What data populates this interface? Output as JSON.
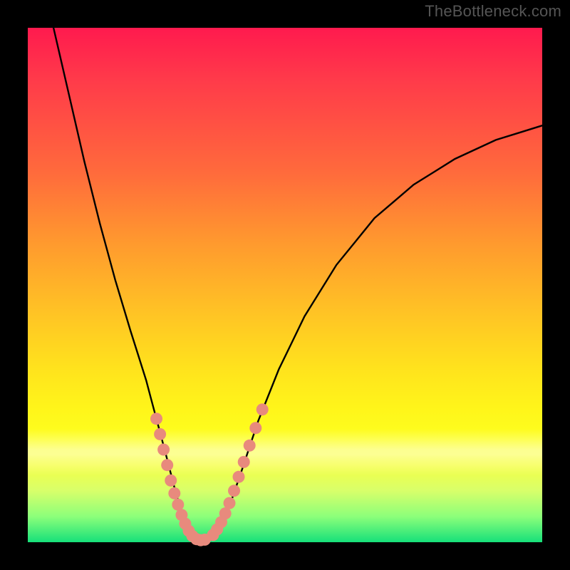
{
  "watermark": {
    "text": "TheBottleneck.com"
  },
  "colors": {
    "frame": "#000000",
    "curve": "#000000",
    "beads": "#e88a7d",
    "gradient_stops": [
      "#ff1a4e",
      "#ff3a4a",
      "#ff6a3c",
      "#ff9a2e",
      "#ffc225",
      "#ffe21d",
      "#fff51a",
      "#fdff1f",
      "#f5ff45",
      "#d8ff6a",
      "#8cff7a",
      "#16e07a"
    ]
  },
  "chart_data": {
    "type": "line",
    "title": "",
    "xlabel": "",
    "ylabel": "",
    "xlim": [
      0,
      100
    ],
    "ylim": [
      0,
      100
    ],
    "grid": false,
    "series": [
      {
        "name": "curve",
        "x": [
          5,
          8,
          11,
          14,
          17,
          20,
          23,
          25,
          27,
          28.8,
          30.3,
          31.6,
          32.7,
          33.8,
          34.9,
          36,
          37.5,
          39.3,
          41.7,
          44.8,
          48.8,
          53.8,
          60,
          67.4,
          75,
          83,
          91,
          100
        ],
        "y": [
          100,
          87,
          74,
          62,
          51,
          41,
          31.5,
          24,
          16.5,
          9.5,
          4.5,
          1.7,
          0.6,
          0.4,
          0.6,
          1.2,
          3.2,
          7.3,
          14.3,
          23.6,
          33.6,
          43.9,
          53.9,
          63,
          69.5,
          74.5,
          78.2,
          81
        ]
      }
    ],
    "bead_clusters": [
      {
        "name": "left-cluster",
        "points": [
          {
            "x": 25.0,
            "y": 24.0
          },
          {
            "x": 25.7,
            "y": 21.0
          },
          {
            "x": 26.4,
            "y": 18.0
          },
          {
            "x": 27.1,
            "y": 15.0
          },
          {
            "x": 27.8,
            "y": 12.0
          },
          {
            "x": 28.5,
            "y": 9.5
          },
          {
            "x": 29.2,
            "y": 7.3
          },
          {
            "x": 29.9,
            "y": 5.3
          },
          {
            "x": 30.6,
            "y": 3.6
          },
          {
            "x": 31.3,
            "y": 2.2
          },
          {
            "x": 32.0,
            "y": 1.2
          },
          {
            "x": 32.8,
            "y": 0.6
          },
          {
            "x": 33.6,
            "y": 0.4
          },
          {
            "x": 34.4,
            "y": 0.5
          }
        ]
      },
      {
        "name": "right-cluster",
        "points": [
          {
            "x": 36.0,
            "y": 1.4
          },
          {
            "x": 36.8,
            "y": 2.5
          },
          {
            "x": 37.6,
            "y": 3.9
          },
          {
            "x": 38.4,
            "y": 5.6
          },
          {
            "x": 39.2,
            "y": 7.6
          },
          {
            "x": 40.1,
            "y": 10.0
          },
          {
            "x": 41.0,
            "y": 12.7
          },
          {
            "x": 42.0,
            "y": 15.6
          },
          {
            "x": 43.1,
            "y": 18.8
          },
          {
            "x": 44.3,
            "y": 22.2
          },
          {
            "x": 45.6,
            "y": 25.8
          }
        ]
      }
    ]
  }
}
